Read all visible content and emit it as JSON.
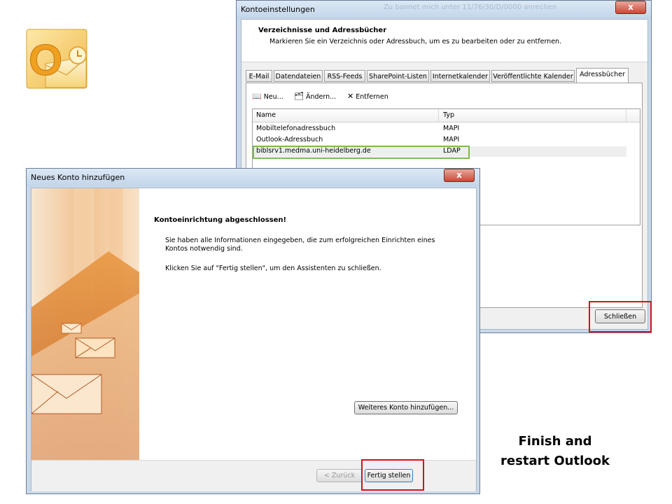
{
  "logo": {
    "icon": "outlook-logo-icon",
    "glyph": "O"
  },
  "konto_window": {
    "title": "Kontoeinstellungen",
    "blurred_title": "Zu bannet mich unter 11/76/30/D/0000 anrechen",
    "close_label": "x",
    "header_title": "Verzeichnisse und Adressbücher",
    "header_subtitle": "Markieren Sie ein Verzeichnis oder Adressbuch, um es zu bearbeiten oder zu entfernen.",
    "tabs": [
      {
        "label": "E-Mail"
      },
      {
        "label": "Datendateien"
      },
      {
        "label": "RSS-Feeds"
      },
      {
        "label": "SharePoint-Listen"
      },
      {
        "label": "Internetkalender"
      },
      {
        "label": "Veröffentlichte Kalender"
      },
      {
        "label": "Adressbücher",
        "active": true
      }
    ],
    "toolbar": {
      "new_label": "Neu...",
      "change_label": "Ändern...",
      "remove_label": "Entfernen"
    },
    "list": {
      "col_name": "Name",
      "col_type": "Typ",
      "rows": [
        {
          "name": "Mobiltelefonadressbuch",
          "type": "MAPI"
        },
        {
          "name": "Outlook-Adressbuch",
          "type": "MAPI"
        },
        {
          "name": "biblsrv1.medma.uni-heidelberg.de",
          "type": "LDAP",
          "selected": true
        }
      ]
    },
    "close_button": "Schließen"
  },
  "wizard_window": {
    "title": "Neues Konto hinzufügen",
    "close_label": "x",
    "content_title": "Kontoeinrichtung abgeschlossen!",
    "paragraph1": "Sie haben alle Informationen eingegeben, die zum erfolgreichen Einrichten eines Kontos notwendig sind.",
    "paragraph2": "Klicken Sie auf \"Fertig stellen\", um den Assistenten zu schließen.",
    "add_account_button": "Weiteres Konto hinzufügen...",
    "back_button": "< Zurück",
    "finish_button": "Fertig stellen"
  },
  "caption": {
    "line1": "Finish and",
    "line2": "restart Outlook"
  },
  "colors": {
    "highlight_green": "#7dbb4a",
    "callout_red": "#d0141c",
    "window_frame": "#c9d9ea"
  }
}
